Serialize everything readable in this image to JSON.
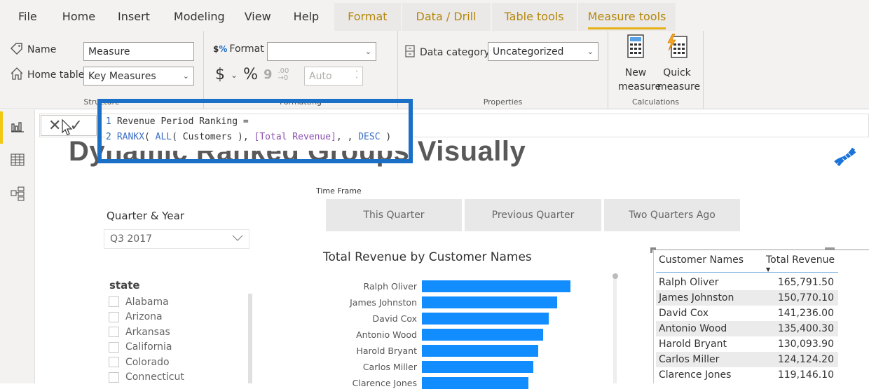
{
  "ribbon": {
    "tabs": [
      {
        "label": "File"
      },
      {
        "label": "Home"
      },
      {
        "label": "Insert"
      },
      {
        "label": "Modeling"
      },
      {
        "label": "View"
      },
      {
        "label": "Help"
      },
      {
        "label": "Format"
      },
      {
        "label": "Data / Drill"
      },
      {
        "label": "Table tools"
      },
      {
        "label": "Measure tools"
      }
    ],
    "active_tab": "Measure tools",
    "structure": {
      "group_label": "Structure",
      "name_label": "Name",
      "name_value": "Measure",
      "home_table_label": "Home table",
      "home_table_value": "Key Measures"
    },
    "formatting": {
      "group_label": "Formatting",
      "format_label": "Format",
      "format_value": "",
      "currency_symbol": "$",
      "percent_symbol": "%",
      "comma_symbol": "9",
      "decimals_value": "Auto"
    },
    "properties": {
      "group_label": "Properties",
      "data_category_label": "Data category",
      "data_category_value": "Uncategorized"
    },
    "calculations": {
      "group_label": "Calculations",
      "new_measure_line1": "New",
      "new_measure_line2": "measure",
      "quick_measure_line1": "Quick",
      "quick_measure_line2": "measure"
    }
  },
  "formula": {
    "line1_num": "1",
    "line1": "Revenue Period Ranking =",
    "line2_num": "2",
    "line2_fn": "RANKX",
    "line2_a": "( ",
    "line2_fn2": "ALL",
    "line2_b": "( Customers ), ",
    "line2_measure": "[Total Revenue]",
    "line2_c": ", , ",
    "line2_kw": "DESC",
    "line2_d": " )"
  },
  "page": {
    "title": "Dynamic Ranked Groups Visually"
  },
  "time_frame": {
    "label": "Time Frame",
    "buttons": [
      "This Quarter",
      "Previous Quarter",
      "Two Quarters Ago"
    ]
  },
  "quarter_slicer": {
    "title": "Quarter & Year",
    "value": "Q3 2017"
  },
  "state_slicer": {
    "title": "state",
    "items": [
      "Alabama",
      "Arizona",
      "Arkansas",
      "California",
      "Colorado",
      "Connecticut"
    ]
  },
  "chart_data": {
    "type": "bar",
    "orientation": "horizontal",
    "title": "Total Revenue by Customer Names",
    "categories": [
      "Ralph Oliver",
      "James Johnston",
      "David Cox",
      "Antonio Wood",
      "Harold Bryant",
      "Carlos Miller",
      "Clarence Jones"
    ],
    "values": [
      165791.5,
      150770.1,
      141236.0,
      135400.3,
      130093.9,
      124124.2,
      119146.1
    ],
    "xlabel": "",
    "ylabel": "",
    "color": "#118dff"
  },
  "table": {
    "headers": [
      "Customer Names",
      "Total Revenue"
    ],
    "rows": [
      [
        "Ralph Oliver",
        "165,791.50"
      ],
      [
        "James Johnston",
        "150,770.10"
      ],
      [
        "David Cox",
        "141,236.00"
      ],
      [
        "Antonio Wood",
        "135,400.30"
      ],
      [
        "Harold Bryant",
        "130,093.90"
      ],
      [
        "Carlos Miller",
        "124,124.20"
      ],
      [
        "Clarence Jones",
        "119,146.10"
      ]
    ]
  }
}
